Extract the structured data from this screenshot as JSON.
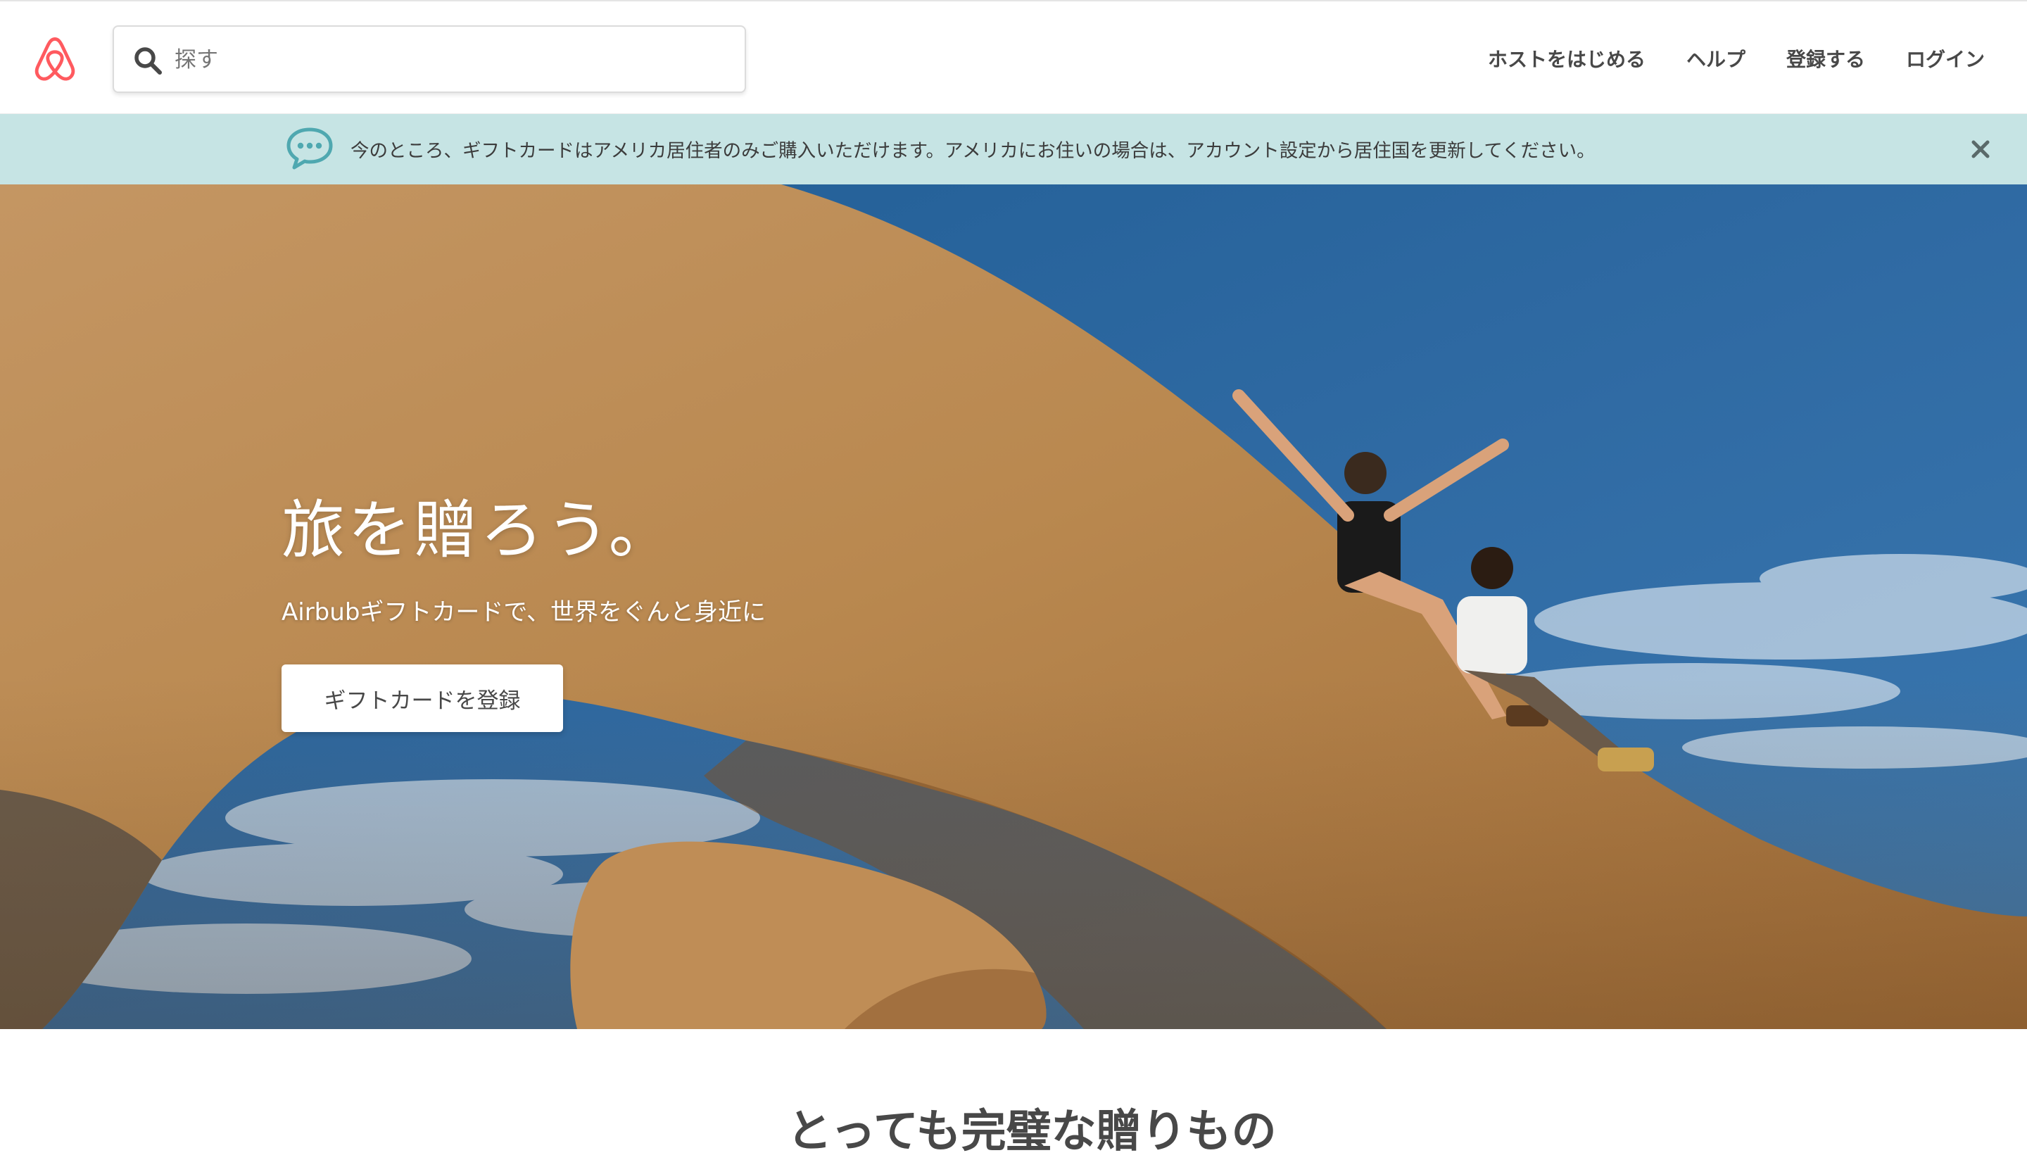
{
  "header": {
    "logo": "airbnb-logo-icon",
    "search": {
      "placeholder": "探す",
      "value": ""
    },
    "nav": [
      {
        "label": "ホストをはじめる"
      },
      {
        "label": "ヘルプ"
      },
      {
        "label": "登録する"
      },
      {
        "label": "ログイン"
      }
    ]
  },
  "banner": {
    "message": "今のところ、ギフトカードはアメリカ居住者のみご購入いただけます。アメリカにお住いの場合は、アカウント設定から居住国を更新してください。",
    "icon": "chat-bubble-icon",
    "close_icon": "close-icon"
  },
  "hero": {
    "title": "旅を贈ろう。",
    "subtitle": "Airbubギフトカードで、世界をぐんと身近に",
    "button_label": "ギフトカードを登録"
  },
  "section": {
    "heading": "とっても完璧な贈りもの"
  },
  "colors": {
    "brand": "#FF5A5F",
    "banner_bg": "#C6E4E4",
    "banner_icon": "#4FA8B0",
    "text": "#484848"
  }
}
